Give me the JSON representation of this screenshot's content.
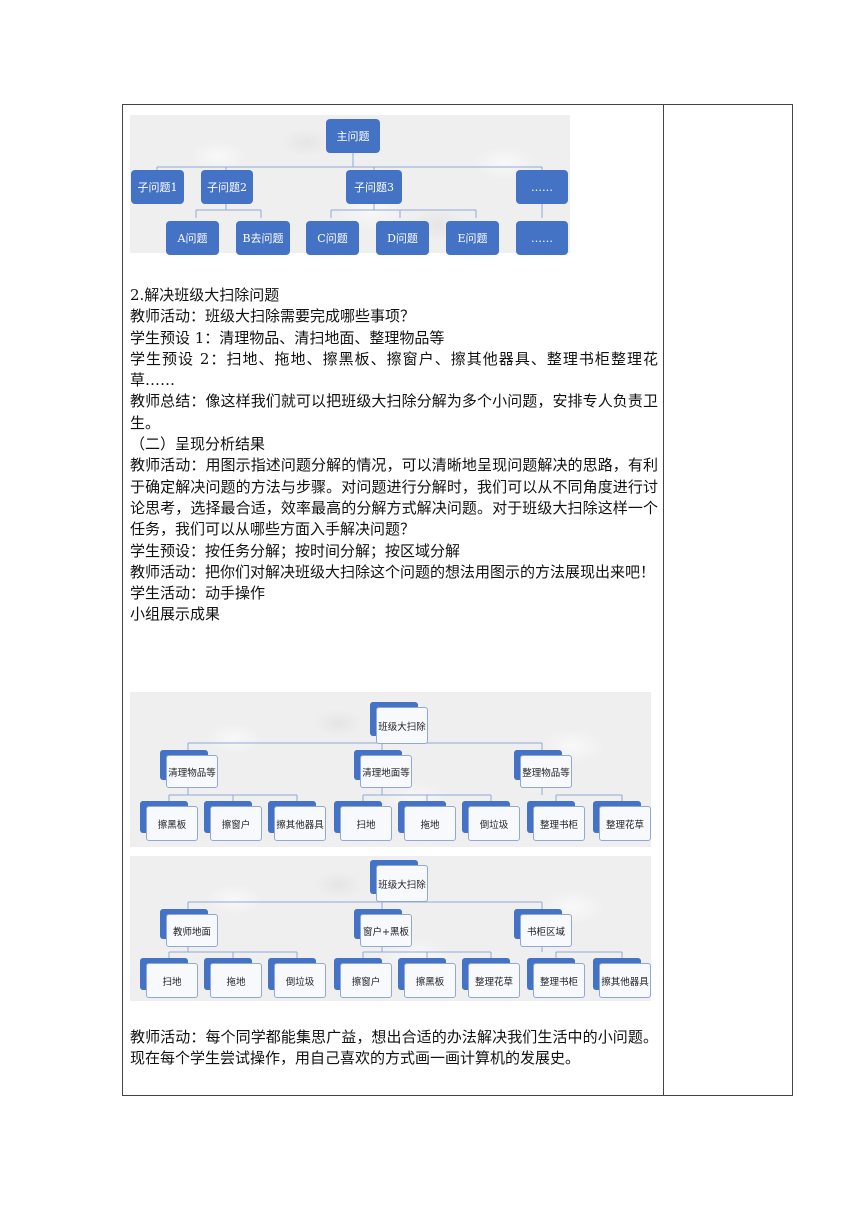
{
  "diagram1": {
    "root": "主问题",
    "level2": [
      "子问题1",
      "子问题2",
      "子问题3",
      "……"
    ],
    "level3": [
      "A问题",
      "B去问题",
      "C问题",
      "D问题",
      "E问题",
      "……"
    ]
  },
  "section2": {
    "lines": [
      "2.解决班级大扫除问题",
      "教师活动：班级大扫除需要完成哪些事项？",
      "学生预设 1：清理物品、清扫地面、整理物品等",
      "学生预设 2：扫地、拖地、擦黑板、擦窗户、擦其他器具、整理书柜整理花草……",
      "教师总结：像这样我们就可以把班级大扫除分解为多个小问题，安排专人负责卫生。",
      "（二）呈现分析结果",
      "教师活动：用图示指述问题分解的情况，可以清晰地呈现问题解决的思路，有利于确定解决问题的方法与步骤。对问题进行分解时，我们可以从不同角度进行讨论思考，选择最合适，效率最高的分解方式解决问题。对于班级大扫除这样一个任务，我们可以从哪些方面入手解决问题？",
      "学生预设：按任务分解；按时间分解；按区域分解",
      "教师活动：把你们对解决班级大扫除这个问题的想法用图示的方法展现出来吧！",
      "学生活动：动手操作",
      "小组展示成果"
    ]
  },
  "diagram2": {
    "root": "班级大扫除",
    "groups": [
      {
        "label": "清理物品等",
        "children": [
          "擦黑板",
          "擦窗户",
          "擦其他器具"
        ]
      },
      {
        "label": "清理地面等",
        "children": [
          "扫地",
          "拖地",
          "倒垃圾"
        ]
      },
      {
        "label": "整理物品等",
        "children": [
          "整理书柜",
          "整理花草"
        ]
      }
    ]
  },
  "diagram3": {
    "root": "班级大扫除",
    "groups": [
      {
        "label": "教师地面",
        "children": [
          "扫地",
          "拖地",
          "倒垃圾"
        ]
      },
      {
        "label": "窗户+黑板",
        "children": [
          "擦窗户",
          "擦黑板",
          "整理花草"
        ]
      },
      {
        "label": "书柜区域",
        "children": [
          "整理书柜",
          "擦其他器具"
        ]
      }
    ]
  },
  "closing": {
    "text": "教师活动：每个同学都能集思广益，想出合适的办法解决我们生活中的小问题。现在每个学生尝试操作，用自己喜欢的方式画一画计算机的发展史。"
  },
  "colors": {
    "box_blue": "#4472c4",
    "connector": "#8fa9d6",
    "border": "#444444"
  }
}
